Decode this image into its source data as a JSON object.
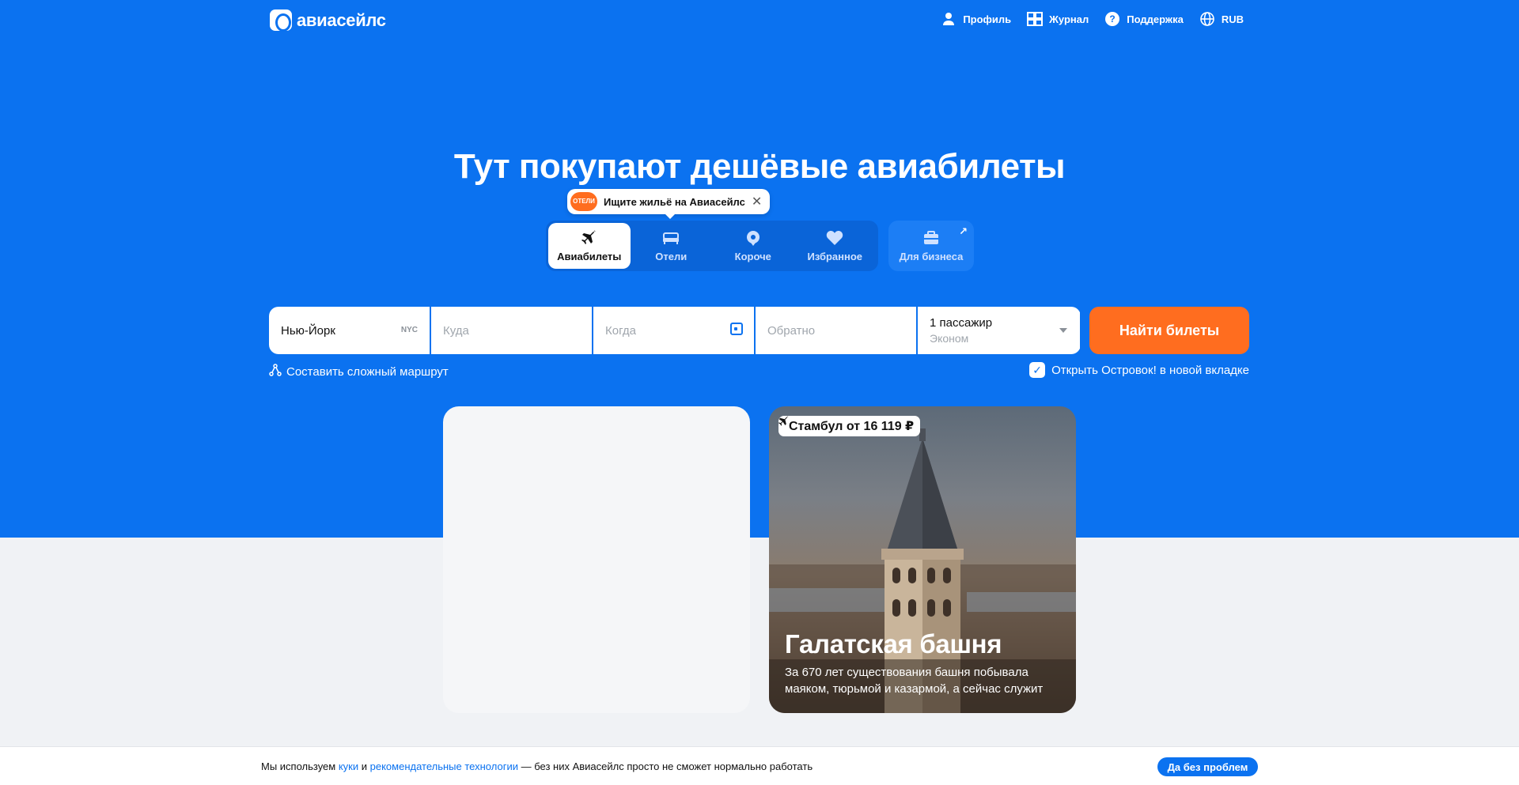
{
  "header": {
    "logo_text": "авиасейлс",
    "nav": [
      {
        "label": "Профиль",
        "icon": "person-icon"
      },
      {
        "label": "Журнал",
        "icon": "journal-icon"
      },
      {
        "label": "Поддержка",
        "icon": "help-icon"
      },
      {
        "label": "RUB",
        "icon": "globe-icon"
      }
    ]
  },
  "hero": {
    "title": "Тут покупают дешёвые авиабилеты"
  },
  "tooltip": {
    "badge": "ОТЕЛИ",
    "text": "Ищите жильё на Авиасейлс"
  },
  "tabs": [
    {
      "label": "Авиабилеты",
      "icon": "plane-icon",
      "active": true
    },
    {
      "label": "Отели",
      "icon": "bed-icon"
    },
    {
      "label": "Короче",
      "icon": "pin-icon"
    },
    {
      "label": "Избранное",
      "icon": "heart-icon"
    },
    {
      "label": "Для бизнеса",
      "icon": "briefcase-icon"
    }
  ],
  "search": {
    "from_value": "Нью-Йорк",
    "from_code": "NYC",
    "to_placeholder": "Куда",
    "when_placeholder": "Когда",
    "return_placeholder": "Обратно",
    "passengers": "1 пассажир",
    "class": "Эконом",
    "find_button": "Найти билеты",
    "complex_route": "Составить сложный маршрут",
    "open_new_tab": "Открыть Островок! в новой вкладке"
  },
  "card": {
    "price": "Стамбул от 16 119 ₽",
    "title": "Галатская башня",
    "text": "За 670 лет существования башня побывала маяком, тюрьмой и казармой, а сейчас служит смотровой площадкой"
  },
  "cookie": {
    "text_start": "Мы используем ",
    "link1": "куки",
    "text_and": " и ",
    "link2": "рекомендательные технологии",
    "text_end": " — без них Авиасейлс просто не сможет нормально работать",
    "button": "Да без проблем"
  },
  "colors": {
    "brand_blue": "#0b72f0",
    "accent_orange": "#ff6d1f"
  }
}
